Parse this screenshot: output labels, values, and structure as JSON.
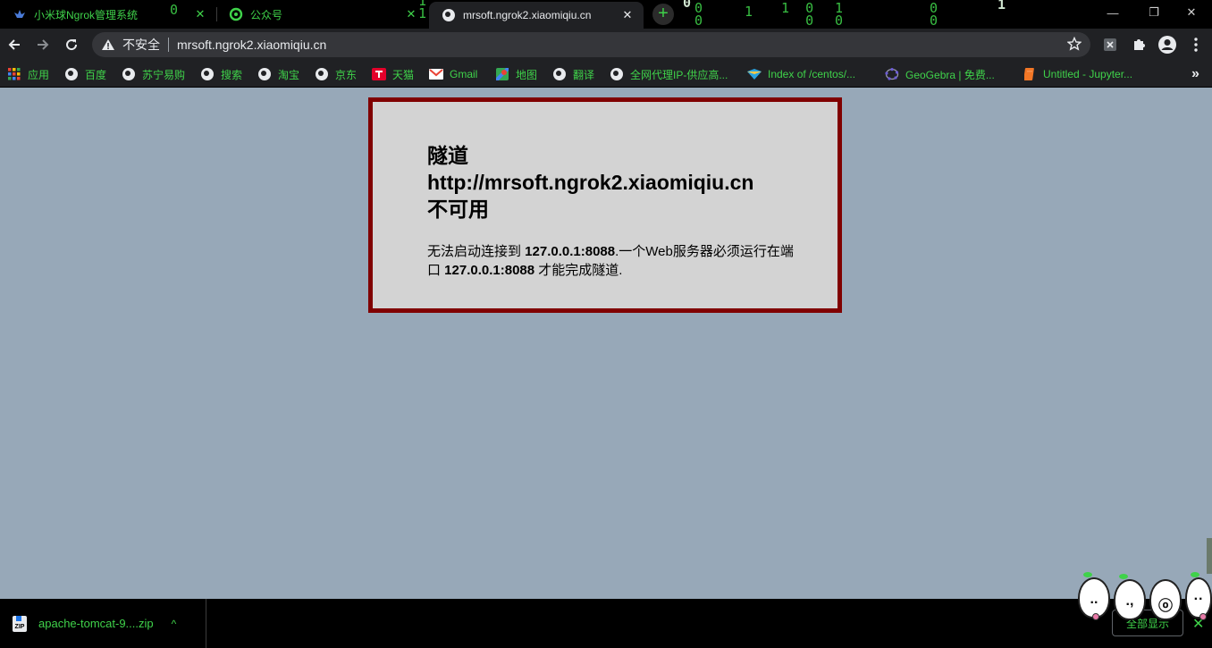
{
  "tabs": [
    {
      "title": "小米球Ngrok管理系统",
      "favicon": "ngrok-logo-icon",
      "active": false
    },
    {
      "title": "公众号",
      "favicon": "wechat-official-icon",
      "active": false
    },
    {
      "title": "mrsoft.ngrok2.xiaomiqiu.cn",
      "favicon": "globe-icon",
      "active": true
    }
  ],
  "tab_close_glyph": "✕",
  "new_tab_glyph": "+",
  "window_controls": {
    "minimize": "—",
    "restore": "❐",
    "close": "✕"
  },
  "toolbar": {
    "security_label": "不安全",
    "url": "mrsoft.ngrok2.xiaomiqiu.cn"
  },
  "bookmarks": [
    {
      "label": "应用",
      "icon": "apps-grid-icon"
    },
    {
      "label": "百度",
      "icon": "globe-icon"
    },
    {
      "label": "苏宁易购",
      "icon": "globe-icon"
    },
    {
      "label": "搜索",
      "icon": "globe-icon"
    },
    {
      "label": "淘宝",
      "icon": "globe-icon"
    },
    {
      "label": "京东",
      "icon": "globe-icon"
    },
    {
      "label": "天猫",
      "icon": "tmall-icon"
    },
    {
      "label": "Gmail",
      "icon": "gmail-icon"
    },
    {
      "label": "地图",
      "icon": "maps-icon"
    },
    {
      "label": "翻译",
      "icon": "globe-icon"
    },
    {
      "label": "全网代理IP-供应高...",
      "icon": "globe-icon"
    },
    {
      "label": "Index of /centos/...",
      "icon": "folder-icon"
    },
    {
      "label": "GeoGebra | 免费...",
      "icon": "geogebra-icon"
    },
    {
      "label": "Untitled - Jupyter...",
      "icon": "jupyter-icon"
    }
  ],
  "bookmarks_more_glyph": "»",
  "error": {
    "title_line1": "隧道",
    "title_line2": "http://mrsoft.ngrok2.xiaomiqiu.cn",
    "title_line3": "不可用",
    "msg_part1": "无法启动连接到 ",
    "msg_addr1": "127.0.0.1:8088",
    "msg_part2": ".一个Web服务器必须运行在端口 ",
    "msg_addr2": "127.0.0.1:8088",
    "msg_part3": " 才能完成隧道."
  },
  "download": {
    "filename": "apache-tomcat-9....zip",
    "icon_text": "ZIP",
    "chevron": "^",
    "show_all": "全部显示",
    "close": "✕"
  },
  "colors": {
    "accent_green": "#3fd24a",
    "page_bg": "#97a8b8",
    "error_border": "#800000",
    "error_bg": "#d3d3d3"
  }
}
